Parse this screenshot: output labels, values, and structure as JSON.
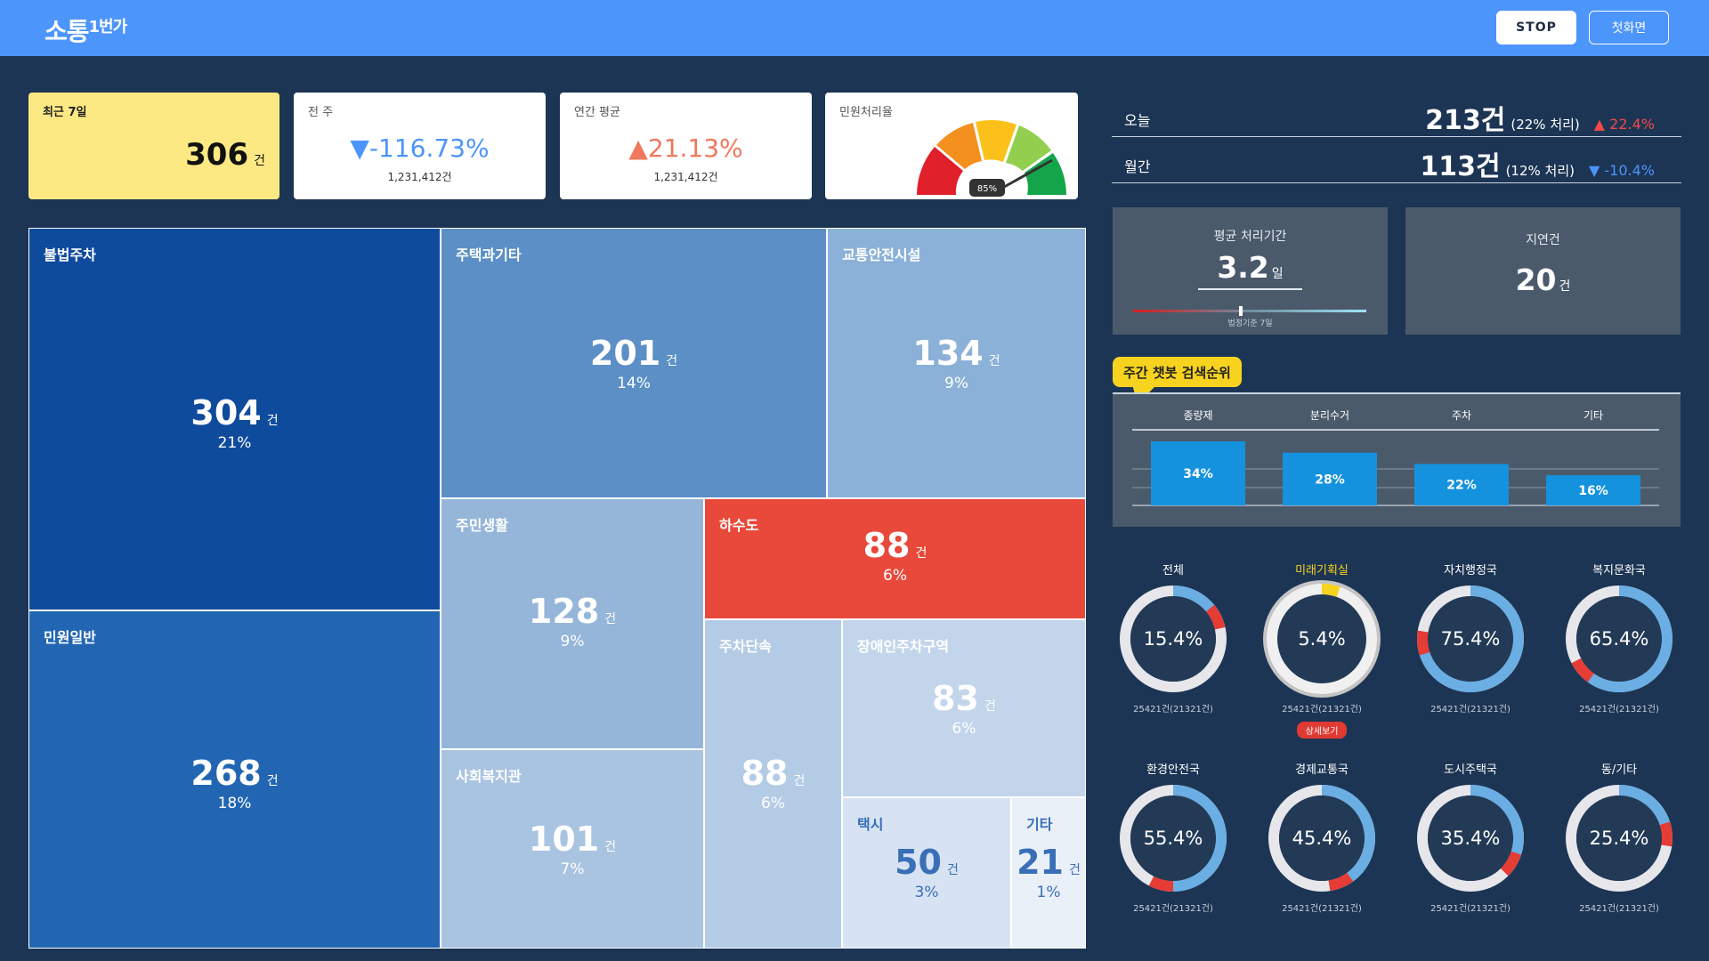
{
  "header": {
    "logo_main": "소통",
    "logo_sub": "1번가",
    "stop_label": "STOP",
    "home_label": "첫화면"
  },
  "kpis": {
    "recent": {
      "label": "최근 7일",
      "value": "306",
      "unit": "건"
    },
    "prev_week": {
      "label": "전 주",
      "value": "▼-116.73%",
      "sub": "1,231,412건"
    },
    "annual": {
      "label": "연간 평균",
      "value": "▲21.13%",
      "sub": "1,231,412건"
    },
    "rate": {
      "label": "민원처리율",
      "value": "85%",
      "percent": 85
    }
  },
  "treemap": {
    "items": [
      {
        "name": "불법주차",
        "value": "304",
        "unit": "건",
        "pct": "21%"
      },
      {
        "name": "민원일반",
        "value": "268",
        "unit": "건",
        "pct": "18%"
      },
      {
        "name": "주택과기타",
        "value": "201",
        "unit": "건",
        "pct": "14%"
      },
      {
        "name": "교통안전시설",
        "value": "134",
        "unit": "건",
        "pct": "9%"
      },
      {
        "name": "주민생활",
        "value": "128",
        "unit": "건",
        "pct": "9%"
      },
      {
        "name": "하수도",
        "value": "88",
        "unit": "건",
        "pct": "6%"
      },
      {
        "name": "사회복지관",
        "value": "101",
        "unit": "건",
        "pct": "7%"
      },
      {
        "name": "주차단속",
        "value": "88",
        "unit": "건",
        "pct": "6%"
      },
      {
        "name": "장애인주차구역",
        "value": "83",
        "unit": "건",
        "pct": "6%"
      },
      {
        "name": "택시",
        "value": "50",
        "unit": "건",
        "pct": "3%"
      },
      {
        "name": "기타",
        "value": "21",
        "unit": "건",
        "pct": "1%"
      }
    ]
  },
  "summary": {
    "today": {
      "label": "오늘",
      "value": "213건",
      "sub": "(22% 처리)",
      "change": "▲ 22.4%"
    },
    "monthly": {
      "label": "월간",
      "value": "113건",
      "sub": "(12% 처리)",
      "change": "▼ -10.4%"
    }
  },
  "avg_period": {
    "title": "평균 처리기간",
    "value": "3.2",
    "unit": "일",
    "caption": "법정기준 7일",
    "fraction": 0.46
  },
  "delayed": {
    "title": "지연건",
    "value": "20",
    "unit": "건"
  },
  "chatbot": {
    "tag": "주간 챗봇 검색순위",
    "chart_data": {
      "type": "bar",
      "categories": [
        "종량제",
        "분리수거",
        "주차",
        "기타"
      ],
      "values": [
        34,
        28,
        22,
        16
      ],
      "value_labels": [
        "34%",
        "28%",
        "22%",
        "16%"
      ]
    }
  },
  "departments": [
    {
      "name": "전체",
      "pct": "15.4%",
      "sub": "25421건(21321건)",
      "highlight": false,
      "red_at": 0.2
    },
    {
      "name": "미래기획실",
      "pct": "5.4%",
      "sub": "25421건(21321건)",
      "highlight": true,
      "detail": "상세보기"
    },
    {
      "name": "자치행정국",
      "pct": "75.4%",
      "sub": "25421건(21321건)",
      "highlight": false,
      "red_at": 0.76
    },
    {
      "name": "복지문화국",
      "pct": "65.4%",
      "sub": "25421건(21321건)",
      "highlight": false,
      "red_at": 0.66
    },
    {
      "name": "환경안전국",
      "pct": "55.4%",
      "sub": "25421건(21321건)",
      "highlight": false,
      "red_at": 0.56
    },
    {
      "name": "경제교통국",
      "pct": "45.4%",
      "sub": "25421건(21321건)",
      "highlight": false,
      "red_at": 0.46
    },
    {
      "name": "도시주택국",
      "pct": "35.4%",
      "sub": "25421건(21321건)",
      "highlight": false,
      "red_at": 0.36
    },
    {
      "name": "동/기타",
      "pct": "25.4%",
      "sub": "25421건(21321건)",
      "highlight": false,
      "red_at": 0.26
    }
  ],
  "colors": {
    "background": "#1d3554",
    "header": "#4c95fb",
    "treemap_red": "#e8493a",
    "panel": "#4b5a6b",
    "bar": "#1592de",
    "donut_blue": "#6aaee3",
    "donut_red": "#e53c35",
    "donut_gray": "#e6e6eb",
    "donut_yellow": "#f7d31f"
  }
}
